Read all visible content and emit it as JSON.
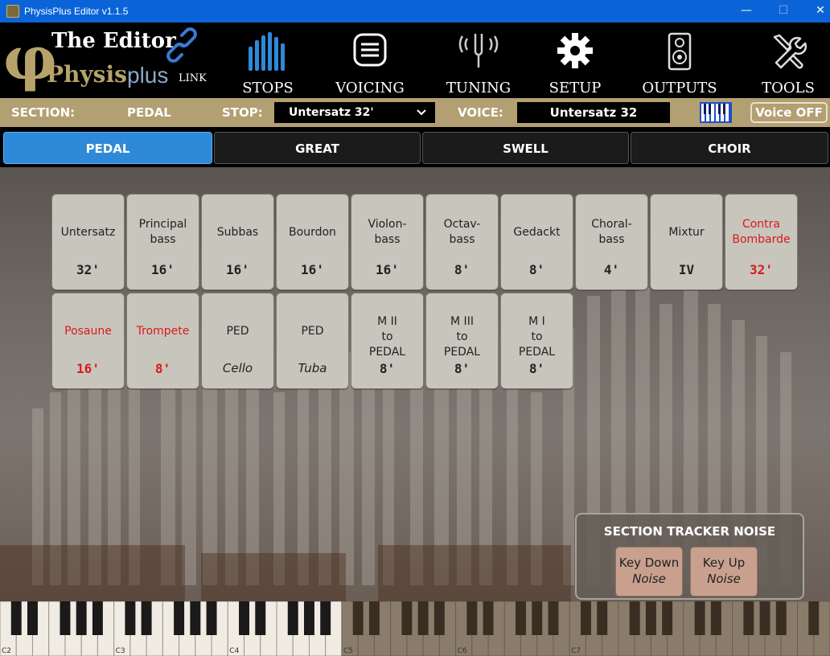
{
  "window": {
    "title": "PhysisPlus Editor v1.1.5",
    "minimize": "—",
    "maximize": "☐",
    "close": "✕"
  },
  "logo": {
    "symbol": "φ",
    "line1": "The Editor",
    "line2": "Physis",
    "plus": "plus",
    "link": "LINK"
  },
  "nav": [
    {
      "label": "STOPS",
      "icon": "organ-pipes-icon"
    },
    {
      "label": "VOICING",
      "icon": "list-icon"
    },
    {
      "label": "TUNING",
      "icon": "tuning-fork-icon"
    },
    {
      "label": "SETUP",
      "icon": "gear-icon"
    },
    {
      "label": "OUTPUTS",
      "icon": "speaker-icon"
    },
    {
      "label": "TOOLS",
      "icon": "tools-icon"
    }
  ],
  "info": {
    "section_label": "SECTION:",
    "section_value": "PEDAL",
    "stop_label": "STOP:",
    "stop_value": "Untersatz 32'",
    "voice_label": "VOICE:",
    "voice_value": "Untersatz 32",
    "voice_off": "Voice OFF"
  },
  "tabs": [
    {
      "label": "PEDAL",
      "active": true
    },
    {
      "label": "GREAT",
      "active": false
    },
    {
      "label": "SWELL",
      "active": false
    },
    {
      "label": "CHOIR",
      "active": false
    }
  ],
  "stops_row1": [
    {
      "name": "Untersatz",
      "size": "32'",
      "reed": false
    },
    {
      "name": "Principal\nbass",
      "size": "16'",
      "reed": false
    },
    {
      "name": "Subbas",
      "size": "16'",
      "reed": false
    },
    {
      "name": "Bourdon",
      "size": "16'",
      "reed": false
    },
    {
      "name": "Violon-\nbass",
      "size": "16'",
      "reed": false
    },
    {
      "name": "Octav-\nbass",
      "size": "8'",
      "reed": false
    },
    {
      "name": "Gedackt",
      "size": "8'",
      "reed": false
    },
    {
      "name": "Choral-\nbass",
      "size": "4'",
      "reed": false
    },
    {
      "name": "Mixtur",
      "size": "IV",
      "reed": false
    },
    {
      "name": "Contra\nBombarde",
      "size": "32'",
      "reed": true
    }
  ],
  "stops_row2": [
    {
      "name": "Posaune",
      "size": "16'",
      "reed": true
    },
    {
      "name": "Trompete",
      "size": "8'",
      "reed": true
    },
    {
      "name": "PED",
      "size": "Cello",
      "italic": true
    },
    {
      "name": "PED",
      "size": "Tuba",
      "italic": true
    },
    {
      "name": "M II\nto\nPEDAL",
      "size": "8'"
    },
    {
      "name": "M III\nto\nPEDAL",
      "size": "8'"
    },
    {
      "name": "M I\nto\nPEDAL",
      "size": "8'"
    }
  ],
  "tracker": {
    "title": "SECTION TRACKER NOISE",
    "key_down": "Key Down",
    "key_up": "Key Up",
    "noise": "Noise"
  },
  "keyboard": {
    "octave_labels": [
      "C2",
      "C3",
      "C4",
      "C5",
      "C6",
      "C7"
    ]
  },
  "colors": {
    "accent": "#2e8ad8",
    "bar": "#b29f72",
    "reed": "#d81a1a",
    "titlebar": "#0a64d8"
  }
}
